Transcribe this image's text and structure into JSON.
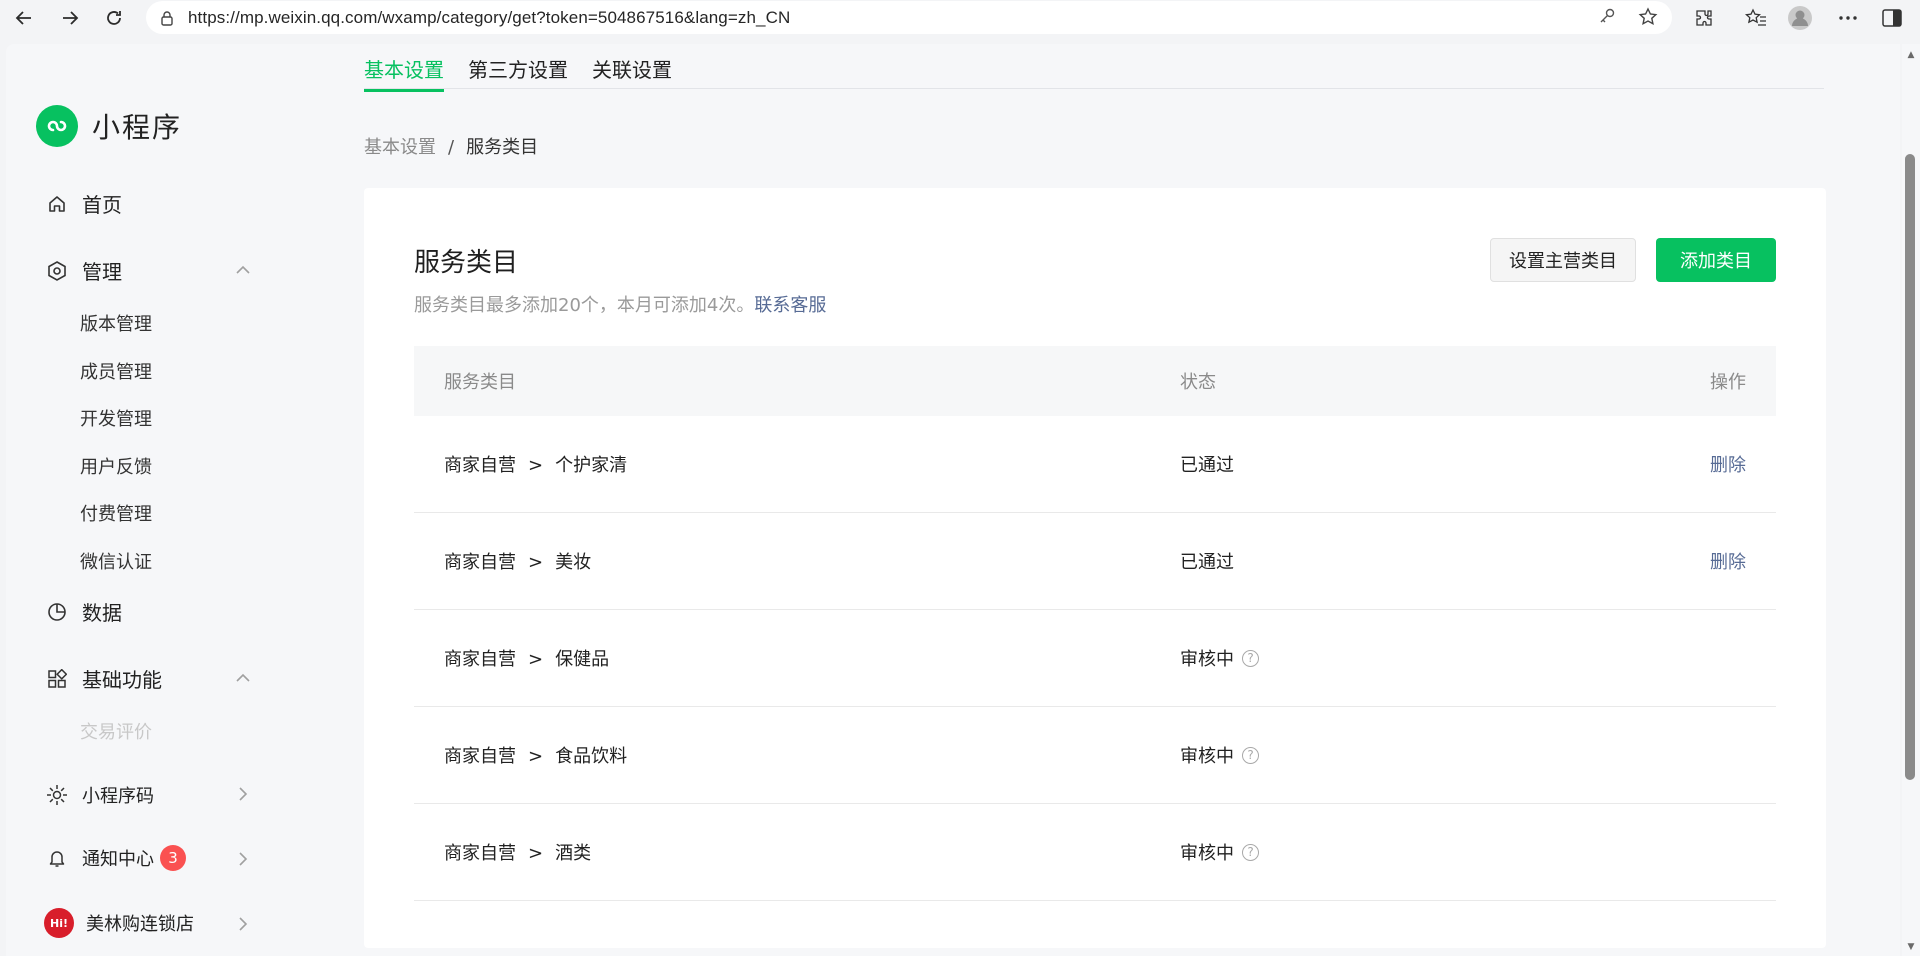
{
  "browser": {
    "url": "https://mp.weixin.qq.com/wxamp/category/get?token=504867516&lang=zh_CN"
  },
  "sidebar": {
    "logo_text": "小程序",
    "home": "首页",
    "manage": {
      "label": "管理",
      "items": [
        "版本管理",
        "成员管理",
        "开发管理",
        "用户反馈",
        "付费管理",
        "微信认证"
      ]
    },
    "data": "数据",
    "basic": {
      "label": "基础功能",
      "items": [
        "交易评价"
      ]
    },
    "qrcode": "小程序码",
    "notify": {
      "label": "通知中心",
      "badge": "3"
    },
    "store": {
      "label": "美林购连锁店",
      "avatar_text": "Hi!"
    }
  },
  "tabs": [
    "基本设置",
    "第三方设置",
    "关联设置"
  ],
  "breadcrumb": {
    "parent": "基本设置",
    "separator": "/",
    "current": "服务类目"
  },
  "card": {
    "title": "服务类目",
    "desc": "服务类目最多添加20个，本月可添加4次。",
    "contact_link": "联系客服",
    "btn_set_main": "设置主营类目",
    "btn_add": "添加类目"
  },
  "table": {
    "headers": [
      "服务类目",
      "状态",
      "操作"
    ],
    "rows": [
      {
        "parent": "商家自营",
        "sep": ">",
        "child": "个护家清",
        "status": "已通过",
        "action": "删除"
      },
      {
        "parent": "商家自营",
        "sep": ">",
        "child": "美妆",
        "status": "已通过",
        "action": "删除"
      },
      {
        "parent": "商家自营",
        "sep": ">",
        "child": "保健品",
        "status": "审核中",
        "action": ""
      },
      {
        "parent": "商家自营",
        "sep": ">",
        "child": "食品饮料",
        "status": "审核中",
        "action": ""
      },
      {
        "parent": "商家自营",
        "sep": ">",
        "child": "酒类",
        "status": "审核中",
        "action": ""
      }
    ]
  },
  "colors": {
    "brand": "#07c160",
    "link": "#576b95",
    "badge": "#fa5151"
  }
}
